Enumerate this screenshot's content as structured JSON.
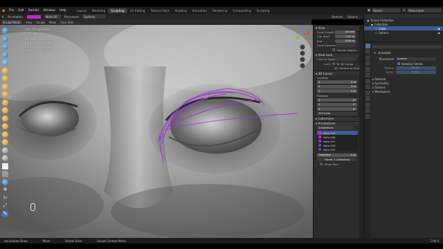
{
  "menus": [
    "File",
    "Edit",
    "Render",
    "Window",
    "Help"
  ],
  "workspaces": [
    {
      "label": "Layout",
      "active": false
    },
    {
      "label": "Modeling",
      "active": false
    },
    {
      "label": "Sculpting",
      "active": true
    },
    {
      "label": "UV Editing",
      "active": false
    },
    {
      "label": "Texture Paint",
      "active": false
    },
    {
      "label": "Shading",
      "active": false
    },
    {
      "label": "Animation",
      "active": false
    },
    {
      "label": "Rendering",
      "active": false
    },
    {
      "label": "Compositing",
      "active": false
    },
    {
      "label": "Scripting",
      "active": false
    }
  ],
  "scene": "Scene",
  "view_layer": "View Layer",
  "header2": {
    "tool_name": "Annotation",
    "note": "Note 00",
    "placement_label": "Placement",
    "placement_value": "Surface",
    "orientation_label": "Orientation",
    "remesh": "Remesh",
    "options": "Options"
  },
  "header3": {
    "mode": "Sculpt Mode",
    "items": [
      "View",
      "Sculpt",
      "Mask",
      "Face Sets"
    ]
  },
  "viewport_info": {
    "line1": "User Perspective",
    "line2": "(1) Cube",
    "stats": [
      {
        "label": "Vertices",
        "value": "262,764"
      },
      {
        "label": "Edges",
        "value": "725,589"
      },
      {
        "label": "Faces",
        "value": "362,822"
      },
      {
        "label": "Triangles",
        "value": "725,516"
      }
    ]
  },
  "npanel": {
    "view_header": "View",
    "focal_length_label": "Focal Length",
    "focal_length": "80 mm",
    "clip_start_label": "Clip Start",
    "clip_start": "0.01 m",
    "clip_end_label": "End",
    "clip_end": "1000 m",
    "local_camera_label": "Local Camera",
    "render_region": "Render Region",
    "view_lock_header": "View Lock",
    "lock_to_object_label": "Lock to Object",
    "lock_label": "Lock",
    "to_3d_cursor": "To 3D Cursor",
    "camera_to_view": "Camera to View",
    "cursor_header": "3D Cursor",
    "location_label": "Location",
    "loc": [
      {
        "axis": "X",
        "value": "0 m"
      },
      {
        "axis": "Y",
        "value": "0 m"
      },
      {
        "axis": "Z",
        "value": "0 m"
      }
    ],
    "rotation_label": "Rotation",
    "rot": [
      {
        "axis": "X",
        "value": "0°"
      },
      {
        "axis": "Y",
        "value": "0°"
      },
      {
        "axis": "Z",
        "value": "0°"
      }
    ],
    "rot_mode": "XYZ Euler",
    "collections_header": "Collections",
    "annotations_header": "Annotations",
    "annotations_name": "Annotations",
    "notes": [
      {
        "name": "Note.008",
        "color": "#d02ac8"
      },
      {
        "name": "Note.008",
        "color": "#c226d6"
      },
      {
        "name": "Note.007",
        "color": "#9b2cd0"
      },
      {
        "name": "Note.006",
        "color": "#7a30c9"
      },
      {
        "name": "Note.003",
        "color": "#6a3ac2"
      }
    ],
    "thickness_label": "Thickness",
    "thickness": "3 px",
    "frame_label": "Frame: 1 (Unlocked)",
    "onion_skin": "Onion Skin"
  },
  "outliner": {
    "title": "Scene Collection",
    "rows": [
      {
        "label": "Collection",
        "selected": false
      },
      {
        "label": "Cube",
        "selected": true
      },
      {
        "label": "Sphere",
        "selected": false
      }
    ]
  },
  "props": {
    "section": "Annotate",
    "placement_label": "Placement",
    "placement_value": "Surface",
    "stabilize_stroke": "Stabilize Stroke",
    "radius_label": "Radius",
    "radius": "35 px",
    "factor_label": "Factor",
    "factor": "0.750",
    "panels": [
      "Remesh",
      "Symmetry",
      "Options",
      "Workspace"
    ]
  },
  "status": {
    "items": [
      "Annotation Draw",
      "Move",
      "Rotate View",
      "Sculpt Context Menu"
    ],
    "version": "2.90.0"
  },
  "colors": {
    "accent": "#4772b3",
    "annotation": "#a233d6",
    "selected_row": "#3a5a92"
  }
}
